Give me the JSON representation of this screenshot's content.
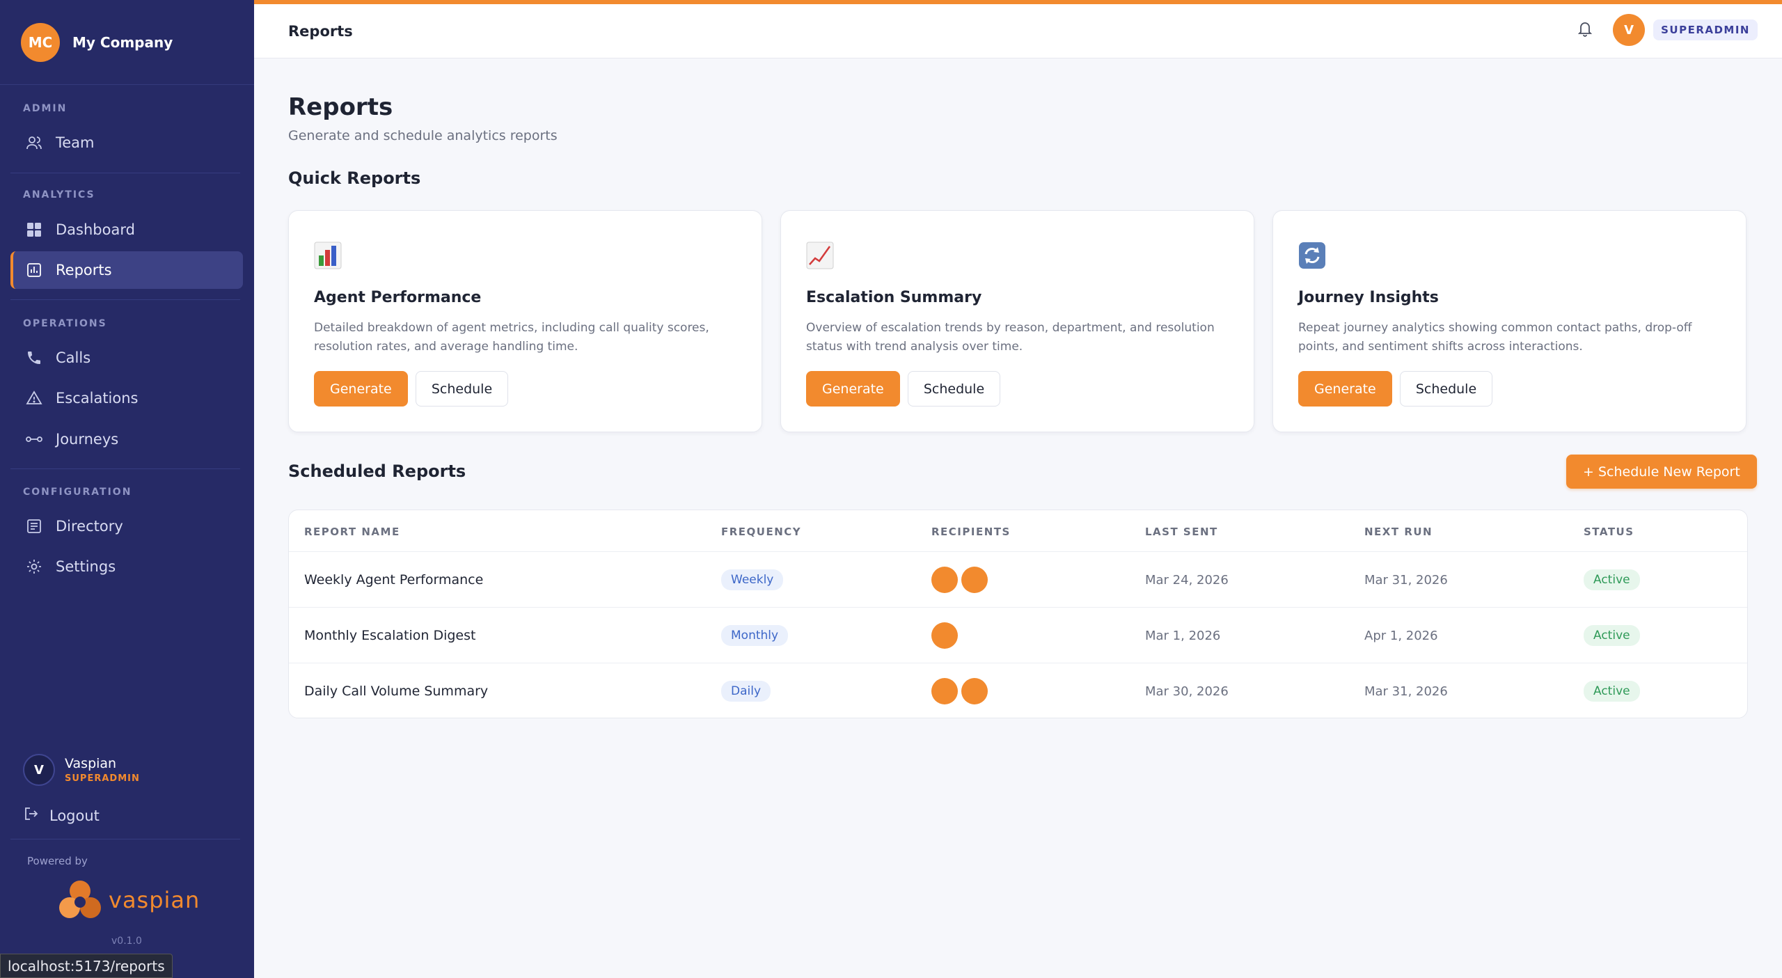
{
  "company": {
    "initials": "MC",
    "name": "My Company"
  },
  "sidebar": {
    "sections": {
      "admin": "ADMIN",
      "analytics": "ANALYTICS",
      "operations": "OPERATIONS",
      "configuration": "CONFIGURATION"
    },
    "items": {
      "team": "Team",
      "dashboard": "Dashboard",
      "reports": "Reports",
      "calls": "Calls",
      "escalations": "Escalations",
      "journeys": "Journeys",
      "directory": "Directory",
      "settings": "Settings"
    },
    "active_item": "reports",
    "user": {
      "initial": "V",
      "name": "Vaspian",
      "role": "SUPERADMIN"
    },
    "logout_label": "Logout",
    "powered_by": "Powered by",
    "brand_word": "vaspian",
    "version": "v0.1.0"
  },
  "topbar": {
    "breadcrumb": "Reports",
    "user_initial": "V",
    "role": "SUPERADMIN"
  },
  "page": {
    "title": "Reports",
    "subtitle": "Generate and schedule analytics reports"
  },
  "quick_reports": {
    "heading": "Quick Reports",
    "cards": [
      {
        "icon": "bar-chart-icon",
        "title": "Agent Performance",
        "description": "Detailed breakdown of agent metrics, including call quality scores, resolution rates, and average handling time.",
        "generate_label": "Generate",
        "schedule_label": "Schedule"
      },
      {
        "icon": "trend-line-icon",
        "title": "Escalation Summary",
        "description": "Overview of escalation trends by reason, department, and resolution status with trend analysis over time.",
        "generate_label": "Generate",
        "schedule_label": "Schedule"
      },
      {
        "icon": "refresh-cycle-icon",
        "title": "Journey Insights",
        "description": "Repeat journey analytics showing common contact paths, drop-off points, and sentiment shifts across interactions.",
        "generate_label": "Generate",
        "schedule_label": "Schedule"
      }
    ]
  },
  "scheduled": {
    "heading": "Scheduled Reports",
    "new_button": "+ Schedule New Report",
    "columns": [
      "REPORT NAME",
      "FREQUENCY",
      "RECIPIENTS",
      "LAST SENT",
      "NEXT RUN",
      "STATUS"
    ],
    "rows": [
      {
        "name": "Weekly Agent Performance",
        "frequency": "Weekly",
        "recipients": 2,
        "last_sent": "Mar 24, 2026",
        "next_run": "Mar 31, 2026",
        "status": "Active"
      },
      {
        "name": "Monthly Escalation Digest",
        "frequency": "Monthly",
        "recipients": 1,
        "last_sent": "Mar 1, 2026",
        "next_run": "Apr 1, 2026",
        "status": "Active"
      },
      {
        "name": "Daily Call Volume Summary",
        "frequency": "Daily",
        "recipients": 2,
        "last_sent": "Mar 30, 2026",
        "next_run": "Mar 31, 2026",
        "status": "Active"
      }
    ]
  },
  "browser_status_url": "localhost:5173/reports",
  "colors": {
    "accent": "#f28a2e",
    "sidebar": "#262a66",
    "active_green": "#2f9a58",
    "freq_blue": "#3d67c8"
  }
}
